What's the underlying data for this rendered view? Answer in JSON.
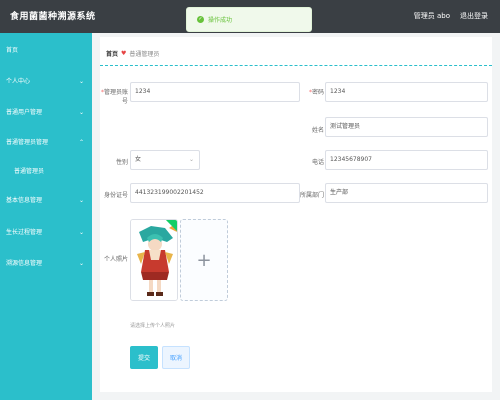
{
  "app": {
    "title": "食用菌菌种溯源系统",
    "user_label": "管理员 abo",
    "logout_label": "退出登录"
  },
  "toast": {
    "message": "操作成功",
    "icon": "check-circle-icon",
    "color": "#67c23a"
  },
  "sidebar": {
    "background": "#2bbfcb",
    "items": [
      {
        "label": "首页"
      },
      {
        "label": "个人中心"
      },
      {
        "label": "普通用户管理"
      },
      {
        "label": "普通管理员管理"
      },
      {
        "label": "普通管理员"
      },
      {
        "label": "基本信息管理"
      },
      {
        "label": "生长过程管理"
      },
      {
        "label": "溯源信息管理"
      }
    ]
  },
  "breadcrumb": {
    "home": "首页",
    "separator": "♥",
    "current": "普通管理员"
  },
  "form": {
    "account": {
      "label": "管理员账号",
      "value": "1234"
    },
    "password": {
      "label": "密码",
      "value": "1234"
    },
    "name": {
      "label": "姓名",
      "value": "测试管理员"
    },
    "gender": {
      "label": "性别",
      "value": "女"
    },
    "phone": {
      "label": "电话",
      "value": "12345678907"
    },
    "id_card": {
      "label": "身份证号",
      "value": "441323199002201452"
    },
    "department": {
      "label": "所属部门",
      "value": "生产部"
    },
    "photo": {
      "label": "个人照片",
      "tip": "请选择上传个人照片"
    },
    "submit_label": "提交",
    "cancel_label": "取消"
  }
}
